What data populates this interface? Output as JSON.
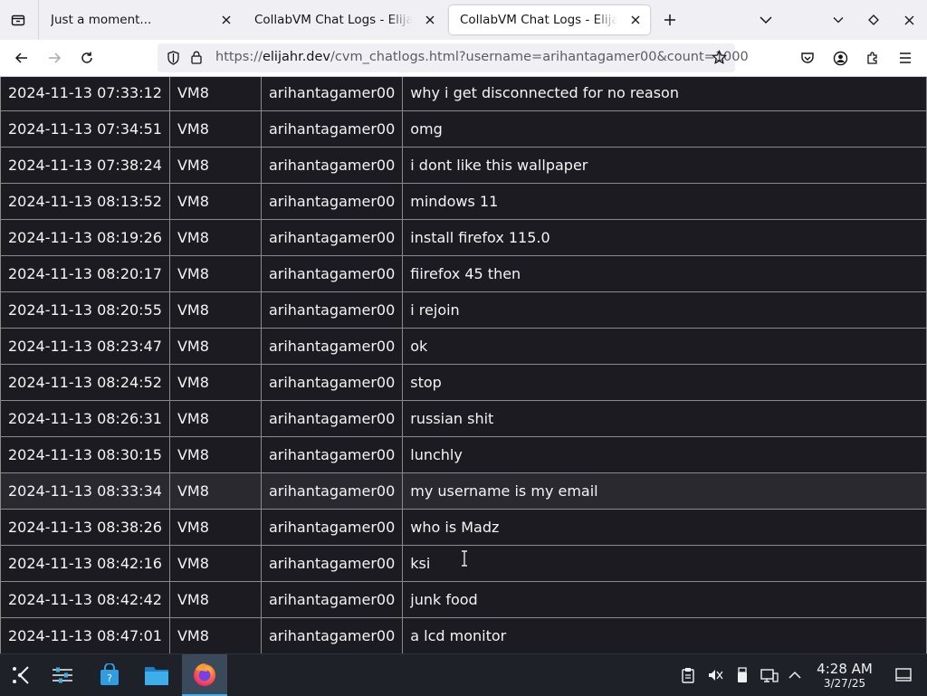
{
  "browser": {
    "tabs": [
      {
        "title": "Just a moment...",
        "active": false
      },
      {
        "title": "CollabVM Chat Logs - Elijahr's",
        "active": false
      },
      {
        "title": "CollabVM Chat Logs - Elijahr's",
        "active": true
      }
    ],
    "url": {
      "scheme": "https://",
      "domain": "elijahr.dev",
      "rest": "/cvm_chatlogs.html?username=arihantagamer00&count=1000"
    }
  },
  "chatlog": {
    "rows": [
      {
        "timestamp": "2024-11-13 07:33:12",
        "vm": "VM8",
        "username": "arihantagamer00",
        "message": "why i get disconnected for no reason"
      },
      {
        "timestamp": "2024-11-13 07:34:51",
        "vm": "VM8",
        "username": "arihantagamer00",
        "message": "omg"
      },
      {
        "timestamp": "2024-11-13 07:38:24",
        "vm": "VM8",
        "username": "arihantagamer00",
        "message": "i dont like this wallpaper"
      },
      {
        "timestamp": "2024-11-13 08:13:52",
        "vm": "VM8",
        "username": "arihantagamer00",
        "message": "mindows 11"
      },
      {
        "timestamp": "2024-11-13 08:19:26",
        "vm": "VM8",
        "username": "arihantagamer00",
        "message": "install firefox 115.0"
      },
      {
        "timestamp": "2024-11-13 08:20:17",
        "vm": "VM8",
        "username": "arihantagamer00",
        "message": "fiirefox 45 then"
      },
      {
        "timestamp": "2024-11-13 08:20:55",
        "vm": "VM8",
        "username": "arihantagamer00",
        "message": "i rejoin"
      },
      {
        "timestamp": "2024-11-13 08:23:47",
        "vm": "VM8",
        "username": "arihantagamer00",
        "message": "ok"
      },
      {
        "timestamp": "2024-11-13 08:24:52",
        "vm": "VM8",
        "username": "arihantagamer00",
        "message": "stop"
      },
      {
        "timestamp": "2024-11-13 08:26:31",
        "vm": "VM8",
        "username": "arihantagamer00",
        "message": "russian shit"
      },
      {
        "timestamp": "2024-11-13 08:30:15",
        "vm": "VM8",
        "username": "arihantagamer00",
        "message": "lunchly"
      },
      {
        "timestamp": "2024-11-13 08:33:34",
        "vm": "VM8",
        "username": "arihantagamer00",
        "message": "my username is my email"
      },
      {
        "timestamp": "2024-11-13 08:38:26",
        "vm": "VM8",
        "username": "arihantagamer00",
        "message": "who is Madz"
      },
      {
        "timestamp": "2024-11-13 08:42:16",
        "vm": "VM8",
        "username": "arihantagamer00",
        "message": "ksi"
      },
      {
        "timestamp": "2024-11-13 08:42:42",
        "vm": "VM8",
        "username": "arihantagamer00",
        "message": "junk food"
      },
      {
        "timestamp": "2024-11-13 08:47:01",
        "vm": "VM8",
        "username": "arihantagamer00",
        "message": "a lcd monitor"
      }
    ],
    "hovered_row": 11
  },
  "taskbar": {
    "clock": {
      "time": "4:28 AM",
      "date": "3/27/25"
    },
    "apps": [
      "application-launcher-icon",
      "system-settings-icon",
      "discover-store-icon",
      "file-manager-icon",
      "firefox-icon"
    ]
  },
  "colors": {
    "page_bg": "#1c1b22",
    "accent": "#3daee9",
    "taskbar_bg": "#1e2128"
  }
}
